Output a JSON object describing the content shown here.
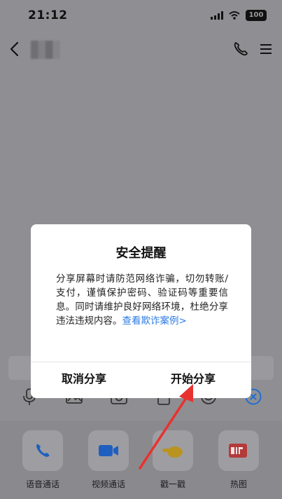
{
  "status_bar": {
    "time": "21:12",
    "battery": "100"
  },
  "header": {
    "contact_name": "",
    "back_icon": "chevron-left-icon",
    "call_icon": "phone-icon",
    "menu_icon": "hamburger-menu-icon"
  },
  "dialog": {
    "title": "安全提醒",
    "body": "分享屏幕时请防范网络诈骗，切勿转账/支付，谨慎保护密码、验证码等重要信息。同时请维护良好网络环境，杜绝分享违法违规内容。",
    "link": "查看欺诈案例>",
    "cancel_label": "取消分享",
    "confirm_label": "开始分享"
  },
  "toolbar": {
    "icons": [
      "microphone-icon",
      "image-icon",
      "camera-icon",
      "file-icon",
      "emoji-icon",
      "close-circle-icon"
    ]
  },
  "actions": [
    {
      "label": "语音通话",
      "icon": "phone-call-icon"
    },
    {
      "label": "视频通话",
      "icon": "video-call-icon"
    },
    {
      "label": "戳一戳",
      "icon": "poke-hand-icon"
    },
    {
      "label": "热图",
      "icon": "gif-icon"
    }
  ],
  "colors": {
    "overlay_bg": "#8f8f93",
    "link": "#2c7be5",
    "arrow": "#e8322f",
    "accent_blue": "#1f6fd1"
  }
}
